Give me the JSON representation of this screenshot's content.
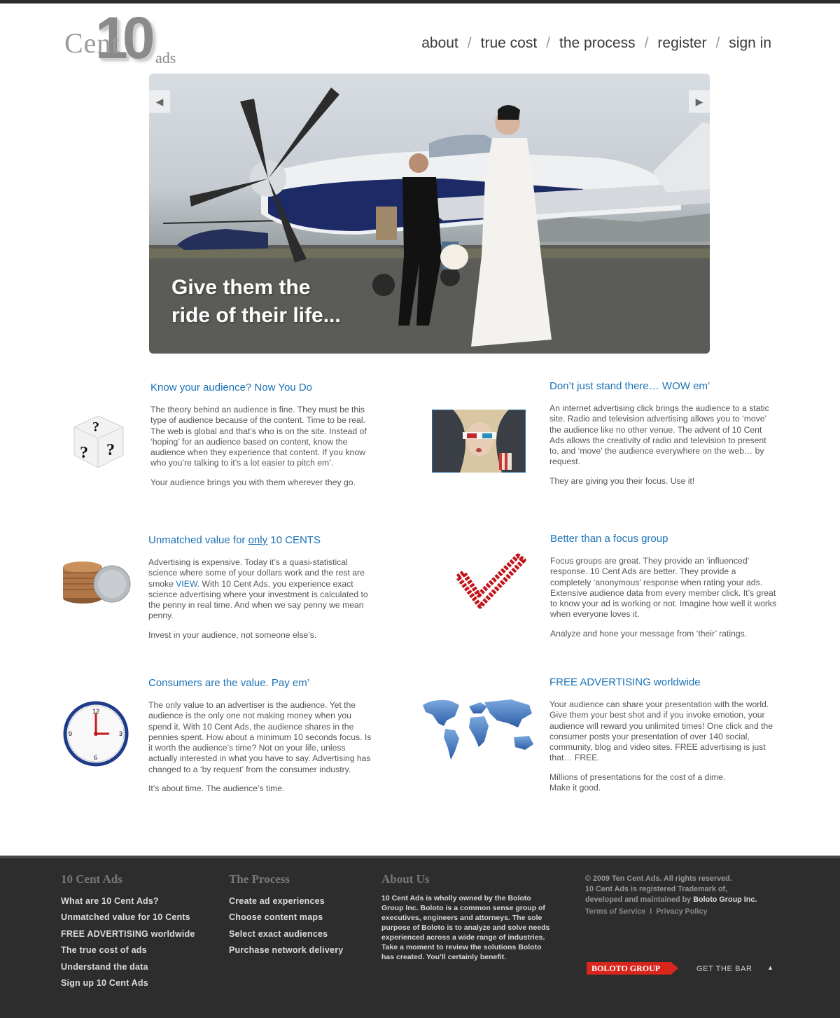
{
  "logo": {
    "ten": "10",
    "cent": "Cent",
    "ads": "ads"
  },
  "nav": {
    "items": [
      {
        "label": "about"
      },
      {
        "label": "true cost"
      },
      {
        "label": "the process"
      },
      {
        "label": "register"
      },
      {
        "label": "sign in"
      }
    ],
    "separator": "/"
  },
  "hero": {
    "caption_line1": "Give them the",
    "caption_line2": "ride of their life...",
    "prev_icon": "triangle-left-icon",
    "next_icon": "triangle-right-icon"
  },
  "features": {
    "audience": {
      "title": "Know your audience?  Now You Do",
      "p1": "The theory behind an audience is fine. They must be this type of audience because of the content. Time to be real. The web is global and that’s who is on the site. Instead of ‘hoping’ for an audience based on content, know the audience when they experience that content. If you know who you’re talking to it’s a lot easier to pitch em’.",
      "p2": "Your audience brings you with them wherever they go."
    },
    "wow": {
      "title": "Don’t just stand there… WOW em’",
      "p1": "An internet advertising click brings the audience to a static site. Radio and television advertising allows you to ‘move’ the audience like no other venue. The advent of 10 Cent Ads allows the creativity of radio and television to present to, and ‘move’ the audience everywhere on the web… by request.",
      "p2": "They are giving you their focus. Use it!"
    },
    "value": {
      "title_pre": "Unmatched value for ",
      "title_only": "only",
      "title_post": " 10 CENTS",
      "p1_pre": "Advertising is expensive. Today it’s a quasi-statistical science where some of your dollars work and the rest are smoke ",
      "p1_link": "VIEW",
      "p1_post": ". With 10 Cent Ads, you experience exact science advertising where your investment is calculated to the penny in real time. And when we say penny we mean penny.",
      "p2": "Invest in your audience, not someone else’s."
    },
    "focus": {
      "title": "Better than a focus group",
      "p1": "Focus groups are great. They provide an ‘influenced’ response. 10 Cent Ads are better. They provide a completely ‘anonymous’ response when rating your ads. Extensive audience data from every member click. It’s great to know your ad is working or not. Imagine how well it works when everyone loves it.",
      "p2": "Analyze and hone your message from ‘their’ ratings."
    },
    "consumers": {
      "title": "Consumers are the value.  Pay em’",
      "p1": "The only value to an advertiser is the audience. Yet the audience is the only one not making money when you spend it. With 10 Cent Ads, the audience shares in the pennies spent. How about a minimum 10 seconds focus. Is it worth the audience’s time? Not on your life, unless actually interested in what you have to say. Advertising has changed to a ‘by request’ from the consumer industry.",
      "p2": "It’s about time. The audience’s time."
    },
    "free": {
      "title": "FREE ADVERTISING worldwide",
      "p1": "Your audience can share your presentation with the world. Give them your best shot and if you invoke emotion, your audience will reward you unlimited times! One click and the consumer posts your presentation of over 140 social, community, blog and video sites. FREE advertising is just that… FREE.",
      "p2a": "Millions of presentations for the cost of a dime.",
      "p2b": "Make it good."
    }
  },
  "footer": {
    "col1": {
      "title": "10 Cent Ads",
      "items": [
        "What are 10 Cent Ads?",
        "Unmatched value for 10 Cents",
        "FREE ADVERTISING worldwide",
        "The true cost of ads",
        "Understand the data",
        "Sign up 10 Cent Ads"
      ]
    },
    "col2": {
      "title": "The Process",
      "items": [
        "Create ad experiences",
        "Choose content maps",
        "Select exact audiences",
        "Purchase network delivery"
      ]
    },
    "col3": {
      "title": "About Us",
      "text": "10 Cent Ads is wholly owned by the Boloto Group Inc.  Boloto is a common sense group of executives, engineers and attorneys. The sole purpose of Boloto is to analyze and solve needs experienced across a wide range of industries. Take a moment to review the solutions Boloto has created. You’ll certainly benefit."
    },
    "copyright_line1": "© 2009 Ten Cent Ads. All rights reserved.",
    "copyright_line2": "10 Cent Ads is registered Trademark of,",
    "copyright_line3_pre": "developed and maintained by ",
    "copyright_line3_co": "Boloto Group Inc.",
    "terms": "Terms of Service",
    "privacy": "Privacy Policy",
    "link_sep": "I",
    "boloto_badge": "BOLOTO GROUP",
    "get_bar": "GET THE BAR",
    "up_icon": "triangle-up-icon"
  },
  "colors": {
    "accent": "#1b72b5",
    "footer_bg": "#2d2d2d",
    "badge_red": "#d9261c"
  }
}
